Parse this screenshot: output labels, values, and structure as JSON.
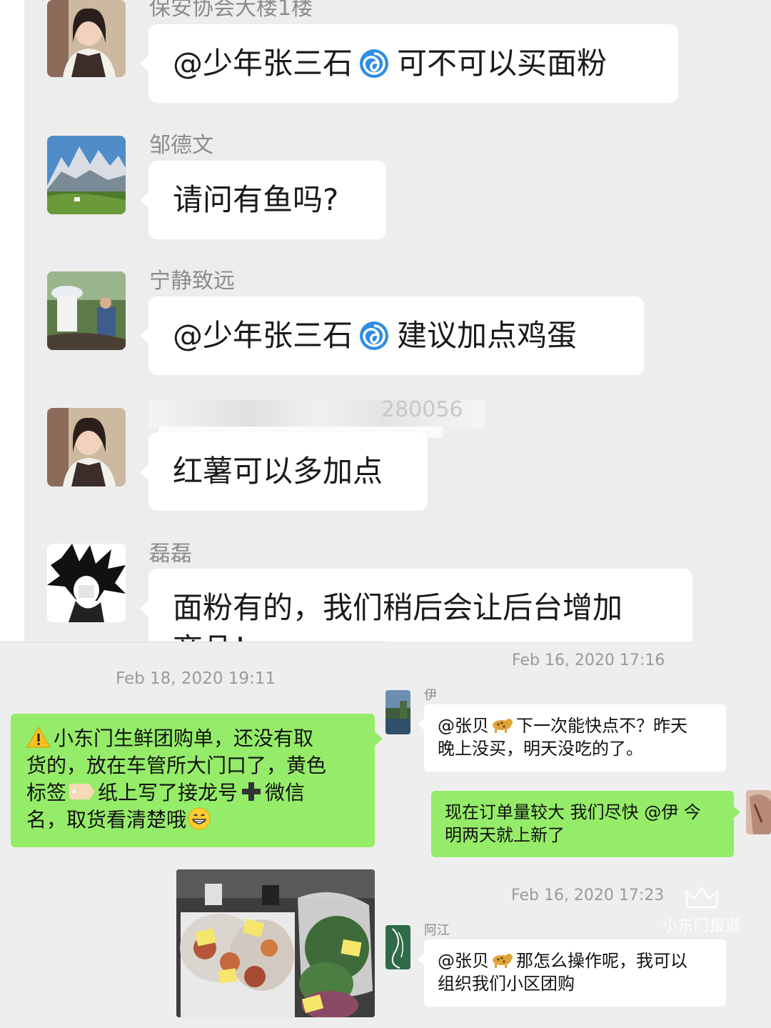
{
  "top_chat": {
    "messages": [
      {
        "sender": "保安协会大楼1楼",
        "text_prefix": "@少年张三石",
        "text_suffix": "可不可以买面粉",
        "has_swirl": true
      },
      {
        "sender": "邹德文",
        "text": "请问有鱼吗?"
      },
      {
        "sender": "宁静致远",
        "text_prefix": "@少年张三石",
        "text_suffix": "建议加点鸡蛋",
        "has_swirl": true
      },
      {
        "sender": "",
        "sender_blurred_digits": "280056",
        "text": "红薯可以多加点"
      },
      {
        "sender": "磊磊",
        "text": "面粉有的，我们稍后会让后台增加",
        "text_cut": "商品！"
      }
    ]
  },
  "left_chat": {
    "timestamp": "Feb 18, 2020 19:11",
    "message_lines": [
      "小东门生鲜团购单，还没有取",
      "货的，放在车管所大门口了，黄色",
      "标签",
      "纸上写了接龙号",
      "微信",
      "名，取货看清楚哦"
    ],
    "photo_alt": "groceries-photo"
  },
  "right_chat": {
    "timestamp_1": "Feb 16, 2020 17:16",
    "msg1": {
      "sender": "伊",
      "line1_prefix": "@张贝",
      "line1_suffix": "下一次能快点不？昨天",
      "line2": "晚上没买，明天没吃的了。"
    },
    "reply": {
      "line1": "现在订单量较大 我们尽快 @伊 今",
      "line2": "明两天就上新了"
    },
    "timestamp_2": "Feb 16, 2020 17:23",
    "msg2": {
      "sender": "阿江",
      "line1_prefix": "@张贝",
      "line1_suffix": "那怎么操作呢，我可以",
      "line2": "组织我们小区团购"
    },
    "watermark": "小东门报道"
  },
  "colors": {
    "bubble_green": "#95ec69",
    "chat_bg": "#ededed",
    "swirl_blue": "#1e88e5"
  }
}
